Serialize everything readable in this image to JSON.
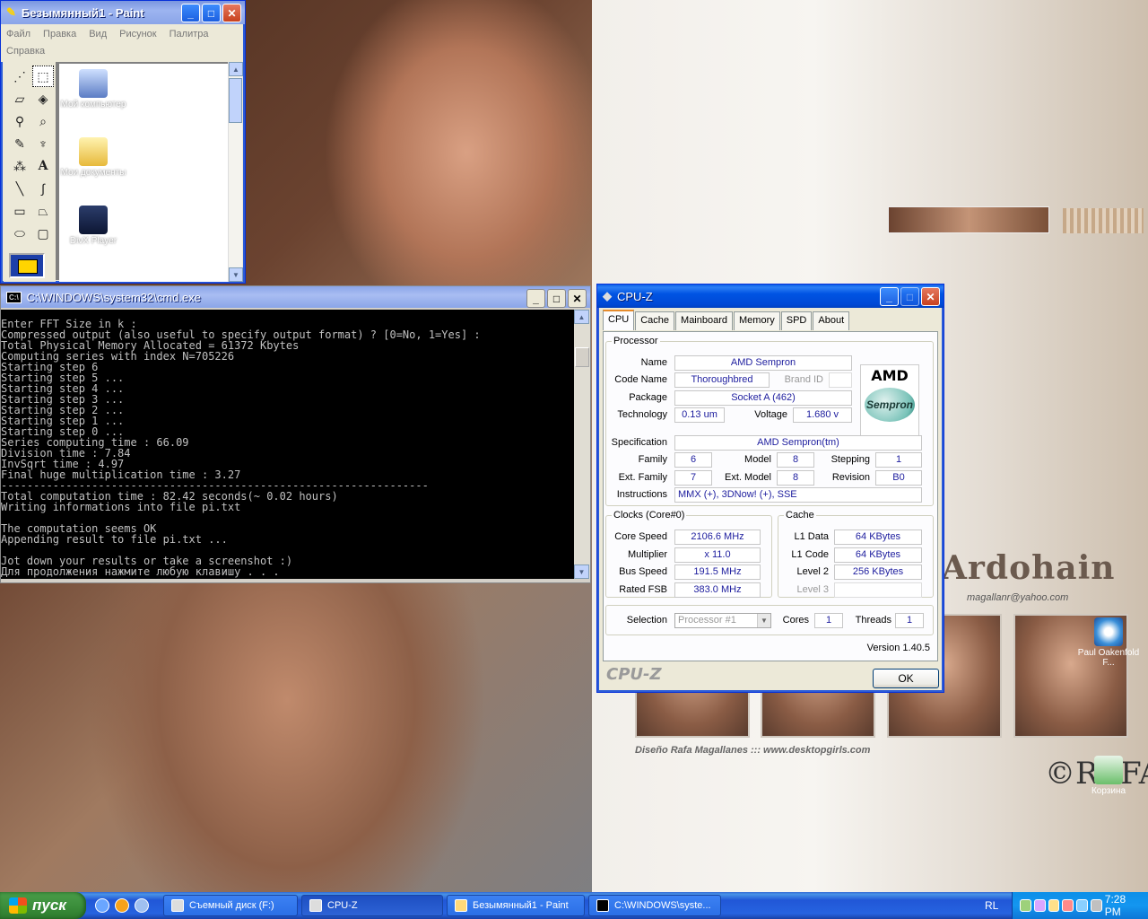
{
  "desktop": {
    "brand": "Ardohain",
    "email": "magallanr@yahoo.com",
    "credit": "Diseño Rafa Magallanes  :::  www.desktopgirls.com",
    "signature": "©RAFA",
    "icons": [
      {
        "label": "Мой компьютер"
      },
      {
        "label": "Мои документы"
      },
      {
        "label": "DivX Player"
      },
      {
        "label": "Paul Oakenfold F..."
      },
      {
        "label": "Корзина"
      }
    ]
  },
  "paint": {
    "title": "Безымянный1 - Paint",
    "menu": [
      "Файл",
      "Правка",
      "Вид",
      "Рисунок",
      "Палитра",
      "Справка"
    ]
  },
  "cmd": {
    "title": "C:\\WINDOWS\\system32\\cmd.exe",
    "lines": [
      "Enter FFT Size in k :",
      "Compressed output (also useful to specify output format) ? [0=No, 1=Yes] :",
      "Total Physical Memory Allocated = 61372 Kbytes",
      "Computing series with index N=705226",
      "Starting step 6",
      "Starting step 5 ...",
      "Starting step 4 ...",
      "Starting step 3 ...",
      "Starting step 2 ...",
      "Starting step 1 ...",
      "Starting step 0 ...",
      "Series computing time : 66.09",
      "Division time : 7.84",
      "InvSqrt time : 4.97",
      "Final huge multiplication time : 3.27",
      "------------------------------------------------------------------",
      "Total computation time : 82.42 seconds(~ 0.02 hours)",
      "Writing informations into file pi.txt",
      "",
      "The computation seems OK",
      "Appending result to file pi.txt ...",
      "",
      "Jot down your results or take a screenshot :)",
      "Для продолжения нажмите любую клавишу . . ."
    ]
  },
  "cpuz": {
    "title": "CPU-Z",
    "tabs": [
      "CPU",
      "Cache",
      "Mainboard",
      "Memory",
      "SPD",
      "About"
    ],
    "processor": {
      "legend": "Processor",
      "name_label": "Name",
      "name": "AMD Sempron",
      "codename_label": "Code Name",
      "codename": "Thoroughbred",
      "brandid_label": "Brand ID",
      "brandid": "",
      "package_label": "Package",
      "package": "Socket A (462)",
      "technology_label": "Technology",
      "technology": "0.13 um",
      "voltage_label": "Voltage",
      "voltage": "1.680 v",
      "spec_label": "Specification",
      "spec": "AMD Sempron(tm)",
      "family_label": "Family",
      "family": "6",
      "model_label": "Model",
      "model": "8",
      "stepping_label": "Stepping",
      "stepping": "1",
      "extfamily_label": "Ext. Family",
      "extfamily": "7",
      "extmodel_label": "Ext. Model",
      "extmodel": "8",
      "revision_label": "Revision",
      "revision": "B0",
      "instructions_label": "Instructions",
      "instructions": "MMX (+), 3DNow! (+), SSE",
      "logo_brand": "AMD",
      "logo_product": "Sempron"
    },
    "clocks": {
      "legend": "Clocks (Core#0)",
      "corespeed_label": "Core Speed",
      "corespeed": "2106.6 MHz",
      "multiplier_label": "Multiplier",
      "multiplier": "x 11.0",
      "busspeed_label": "Bus Speed",
      "busspeed": "191.5 MHz",
      "ratedfsb_label": "Rated FSB",
      "ratedfsb": "383.0 MHz"
    },
    "cache": {
      "legend": "Cache",
      "l1data_label": "L1 Data",
      "l1data": "64 KBytes",
      "l1code_label": "L1 Code",
      "l1code": "64 KBytes",
      "level2_label": "Level 2",
      "level2": "256 KBytes",
      "level3_label": "Level 3",
      "level3": ""
    },
    "selection_label": "Selection",
    "selection": "Processor #1",
    "cores_label": "Cores",
    "cores": "1",
    "threads_label": "Threads",
    "threads": "1",
    "version": "Version 1.40.5",
    "footer": "CPU-Z",
    "ok": "OK"
  },
  "taskbar": {
    "start": "пуск",
    "tasks": [
      "Съемный диск (F:)",
      "CPU-Z",
      "Безымянный1 - Paint",
      "C:\\WINDOWS\\syste..."
    ],
    "lang": "RL",
    "clock": "7:28 PM"
  }
}
